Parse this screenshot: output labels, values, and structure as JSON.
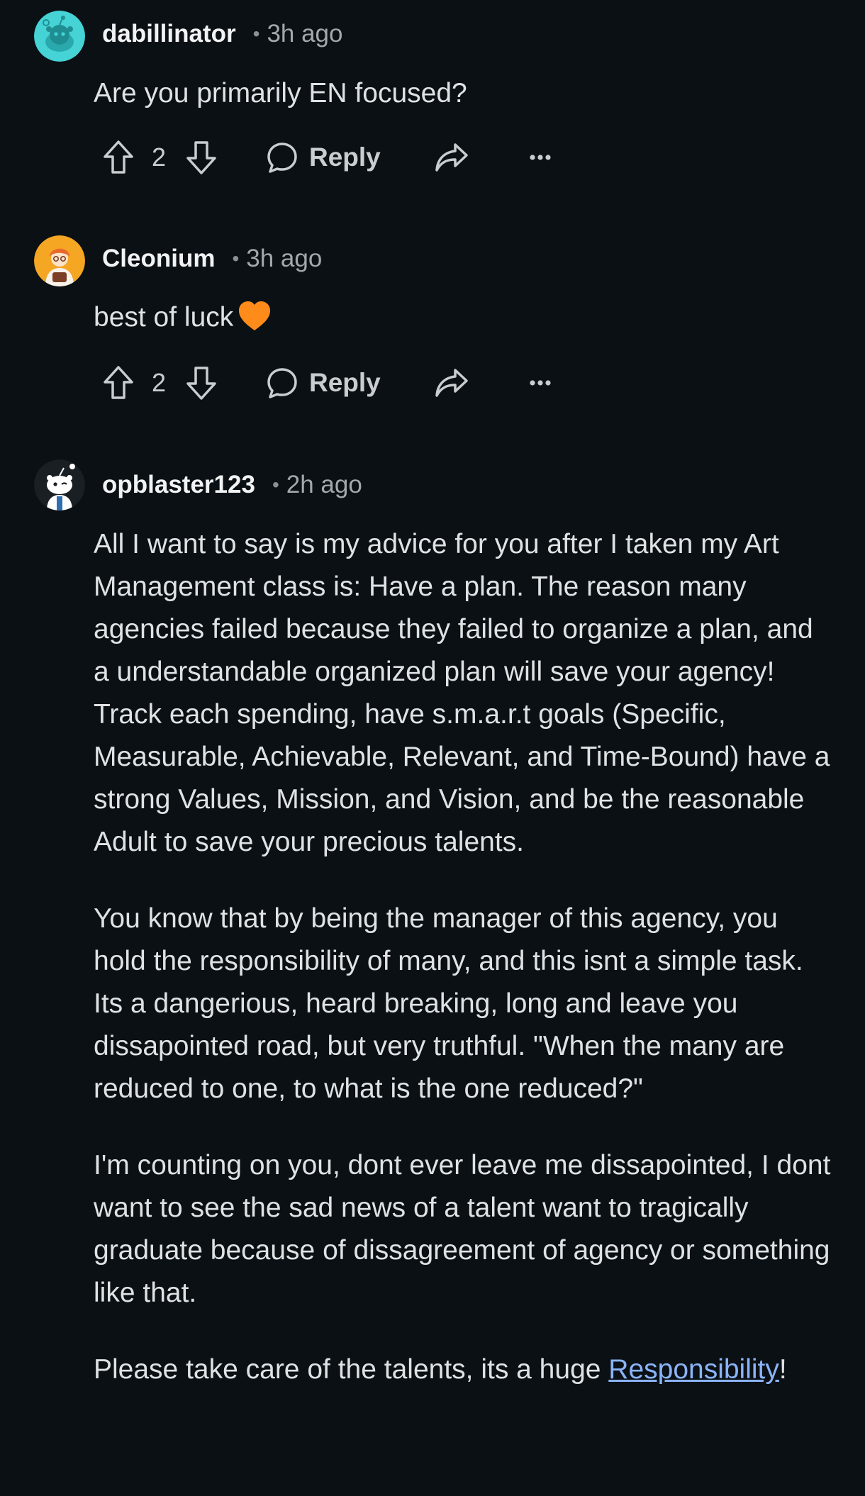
{
  "comments": [
    {
      "username": "dabillinator",
      "time": "3h ago",
      "text": "Are you primarily EN focused?",
      "votes": "2",
      "reply_label": "Reply"
    },
    {
      "username": "Cleonium",
      "time": "3h ago",
      "text": "best of luck",
      "votes": "2",
      "reply_label": "Reply"
    },
    {
      "username": "opblaster123",
      "time": "2h ago",
      "paragraphs": [
        "All I want to say is my advice for you after I taken my Art Management class is: Have a plan. The reason many agencies failed because they failed to organize a plan, and a understandable organized plan will save your agency! Track each spending, have s.m.a.r.t goals (Specific, Measurable, Achievable, Relevant, and Time-Bound) have a strong Values, Mission, and Vision, and be the reasonable Adult to save your precious talents.",
        "You know that by being the manager of this agency, you hold the responsibility of many, and this isnt a simple task. Its a dangerious, heard breaking, long and leave you dissapointed road, but very truthful. \"When the many are reduced to one, to what is the one reduced?\"",
        "I'm counting on you, dont ever leave me dissapointed, I dont want to see the sad news of a talent want to tragically graduate because of dissagreement of agency or something like that."
      ],
      "last_paragraph_prefix": "Please take care of the talents, its a huge ",
      "link_text": "Responsibility",
      "last_paragraph_suffix": "!"
    }
  ],
  "icons": {
    "upvote": "upvote-arrow-icon",
    "downvote": "downvote-arrow-icon",
    "reply": "speech-bubble-icon",
    "share": "share-arrow-icon",
    "more": "more-options-icon",
    "heart": "orange-heart-emoji"
  },
  "colors": {
    "background": "#0b1014",
    "link": "#8ab4f8",
    "heart": "#ff8c1a",
    "avatar_1": "#45d3d6",
    "avatar_2": "#f5a623"
  }
}
